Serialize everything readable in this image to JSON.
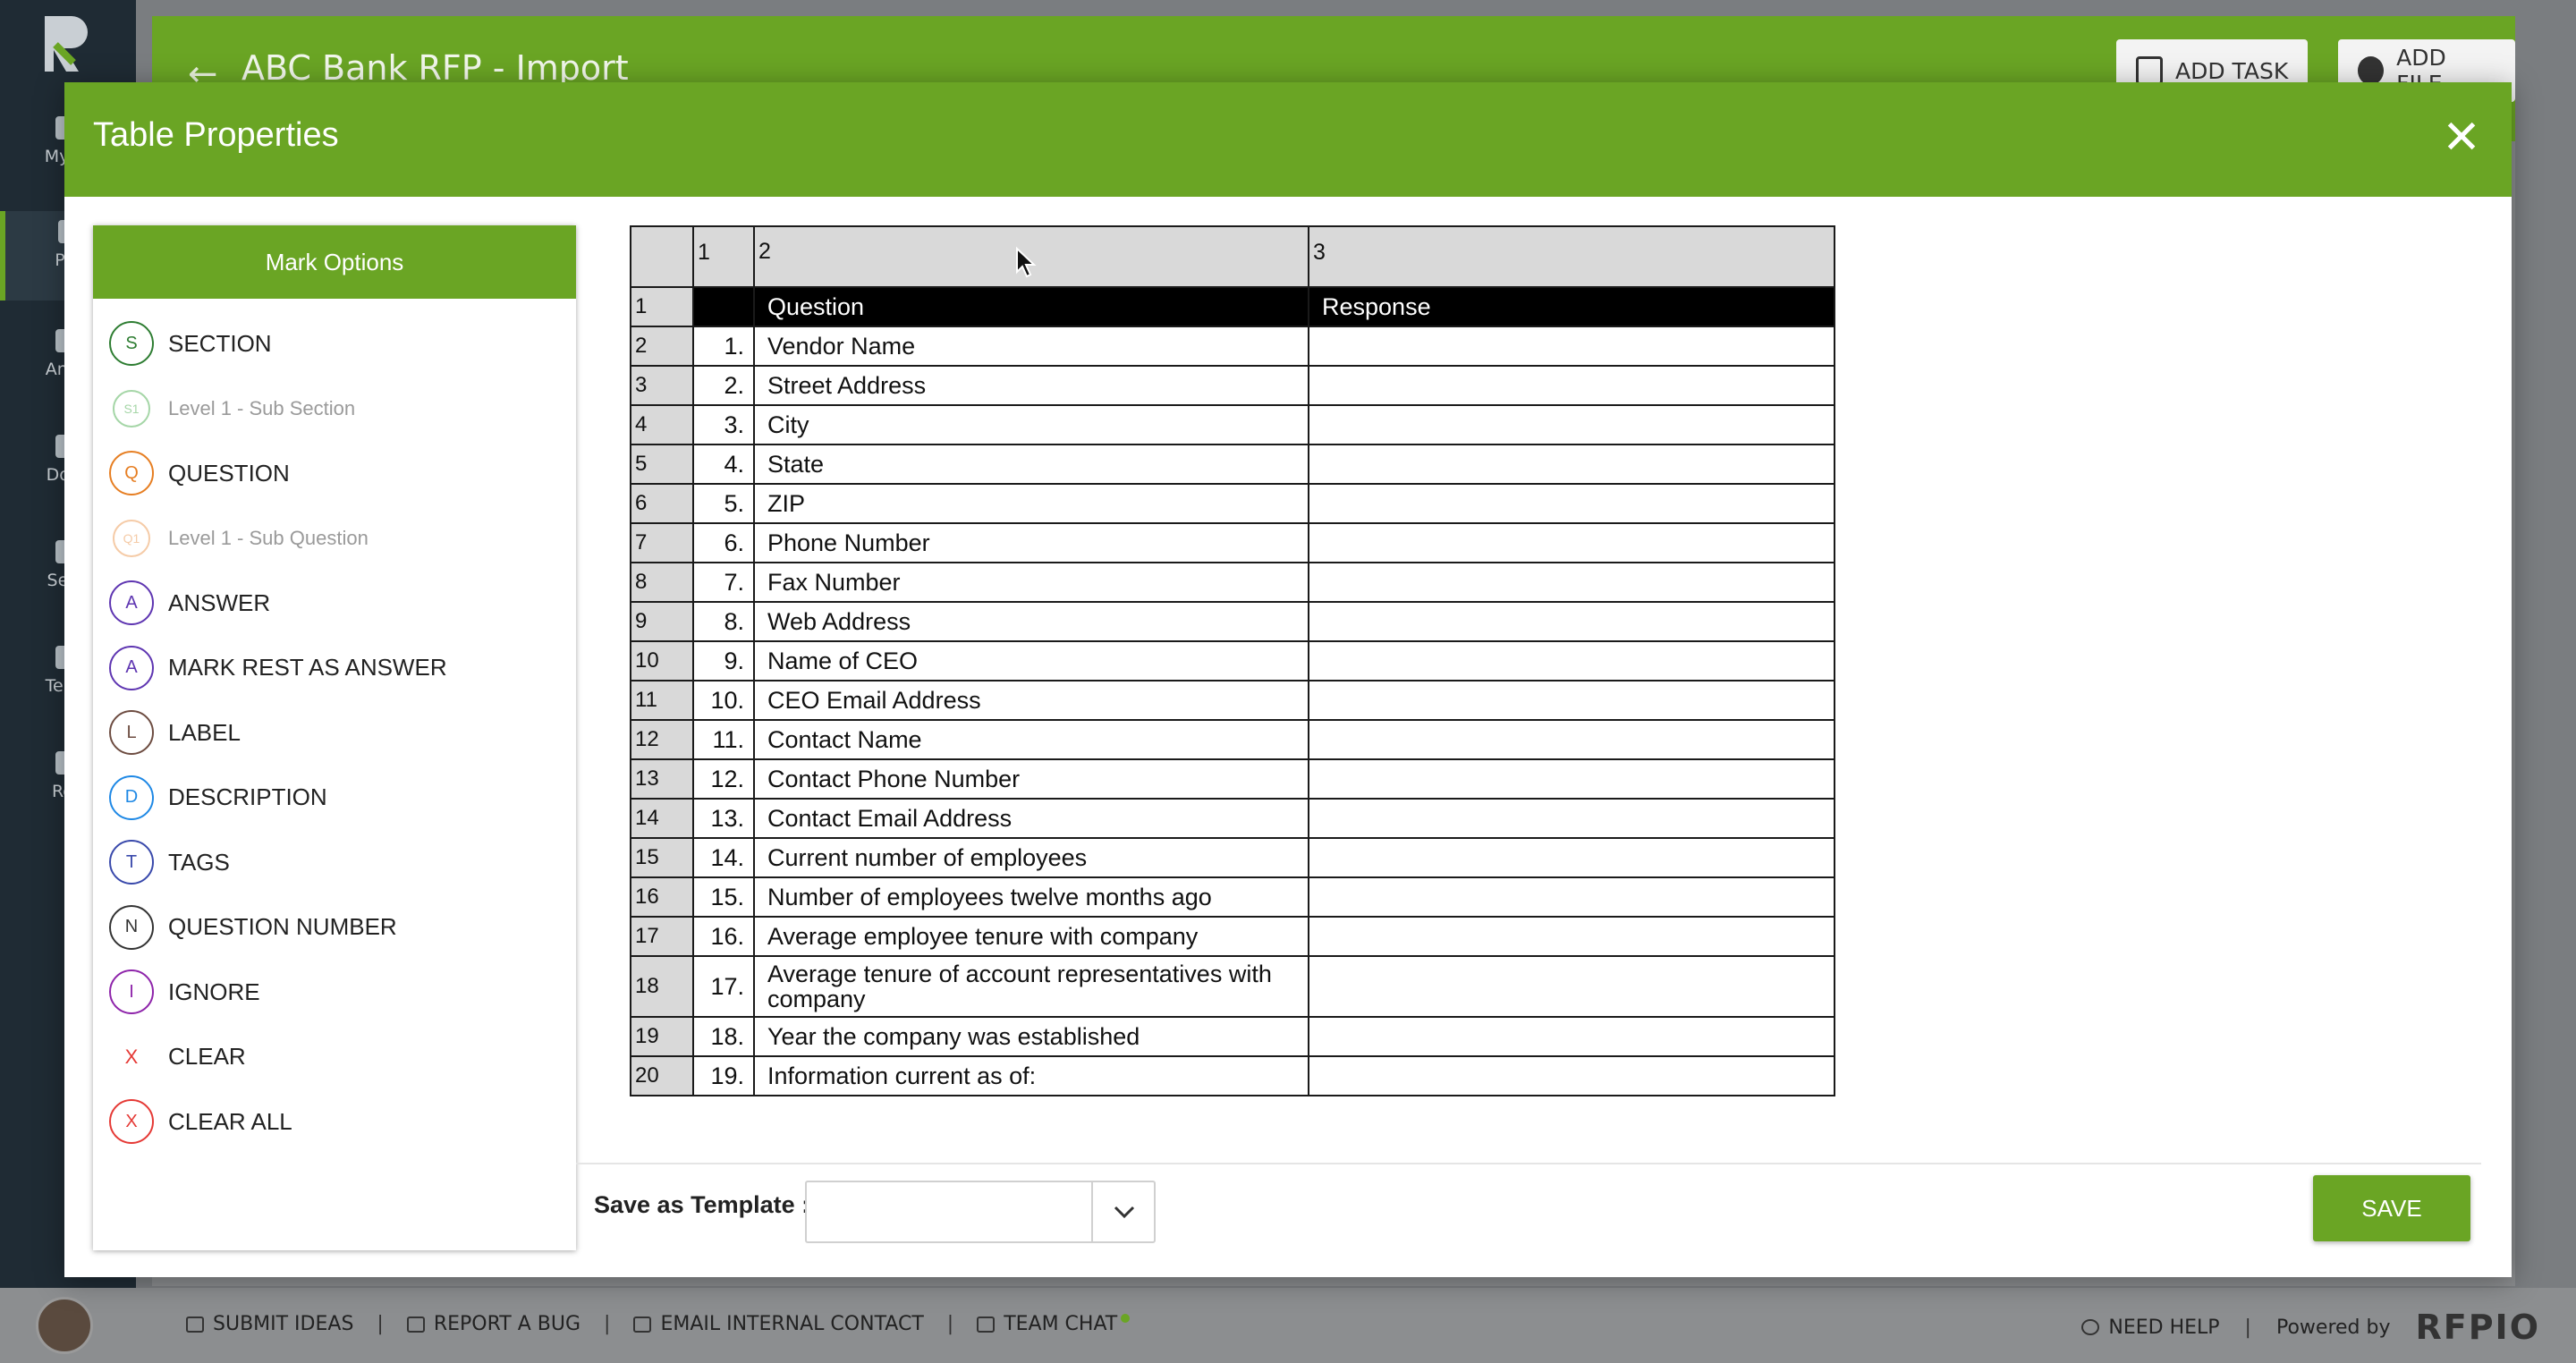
{
  "app": {
    "project_title": "ABC Bank RFP - Import",
    "add_task_label": "ADD TASK",
    "add_file_label": "ADD FILE",
    "rail_items": [
      "My W",
      "Proj",
      "Answ",
      "Docu",
      "Secti",
      "Temp",
      "Rep"
    ]
  },
  "bottom_bar": {
    "links": [
      "SUBMIT IDEAS",
      "REPORT A BUG",
      "EMAIL INTERNAL CONTACT",
      "TEAM CHAT"
    ],
    "need_help": "NEED HELP",
    "powered_by": "Powered by",
    "brand": "RFPIO"
  },
  "modal": {
    "title": "Table Properties",
    "close_icon": "close-icon"
  },
  "mark_options": {
    "heading": "Mark Options",
    "items": [
      {
        "letter": "S",
        "label": "SECTION",
        "color": "#2e7d32",
        "sub": false
      },
      {
        "letter": "S1",
        "label": "Level 1 - Sub Section",
        "color": "#a5d6a7",
        "sub": true
      },
      {
        "letter": "Q",
        "label": "QUESTION",
        "color": "#e67e22",
        "sub": false
      },
      {
        "letter": "Q1",
        "label": "Level 1 - Sub Question",
        "color": "#f5cba7",
        "sub": true
      },
      {
        "letter": "A",
        "label": "ANSWER",
        "color": "#5e35b1",
        "sub": false
      },
      {
        "letter": "A",
        "label": "MARK REST AS ANSWER",
        "color": "#5e35b1",
        "sub": false
      },
      {
        "letter": "L",
        "label": "LABEL",
        "color": "#6d4c41",
        "sub": false
      },
      {
        "letter": "D",
        "label": "DESCRIPTION",
        "color": "#1e88e5",
        "sub": false
      },
      {
        "letter": "T",
        "label": "TAGS",
        "color": "#3949ab",
        "sub": false
      },
      {
        "letter": "N",
        "label": "QUESTION NUMBER",
        "color": "#333333",
        "sub": false
      },
      {
        "letter": "I",
        "label": "IGNORE",
        "color": "#8e24aa",
        "sub": false
      },
      {
        "letter": "X",
        "label": "CLEAR",
        "color": "#e53935",
        "sub": false,
        "plain": true
      },
      {
        "letter": "X",
        "label": "CLEAR ALL",
        "color": "#e53935",
        "sub": false
      }
    ]
  },
  "table": {
    "column_headers": [
      "1",
      "2",
      "3"
    ],
    "rows": [
      {
        "row": "1",
        "num": "",
        "question": "Question",
        "response": "Response",
        "header": true
      },
      {
        "row": "2",
        "num": "1.",
        "question": "Vendor Name",
        "response": ""
      },
      {
        "row": "3",
        "num": "2.",
        "question": "Street Address",
        "response": ""
      },
      {
        "row": "4",
        "num": "3.",
        "question": "City",
        "response": ""
      },
      {
        "row": "5",
        "num": "4.",
        "question": "State",
        "response": ""
      },
      {
        "row": "6",
        "num": "5.",
        "question": "ZIP",
        "response": ""
      },
      {
        "row": "7",
        "num": "6.",
        "question": "Phone Number",
        "response": ""
      },
      {
        "row": "8",
        "num": "7.",
        "question": "Fax Number",
        "response": ""
      },
      {
        "row": "9",
        "num": "8.",
        "question": "Web Address",
        "response": ""
      },
      {
        "row": "10",
        "num": "9.",
        "question": "Name of CEO",
        "response": ""
      },
      {
        "row": "11",
        "num": "10.",
        "question": "CEO Email Address",
        "response": ""
      },
      {
        "row": "12",
        "num": "11.",
        "question": "Contact Name",
        "response": ""
      },
      {
        "row": "13",
        "num": "12.",
        "question": "Contact Phone Number",
        "response": ""
      },
      {
        "row": "14",
        "num": "13.",
        "question": "Contact Email Address",
        "response": ""
      },
      {
        "row": "15",
        "num": "14.",
        "question": "Current number of employees",
        "response": ""
      },
      {
        "row": "16",
        "num": "15.",
        "question": "Number of employees twelve months ago",
        "response": ""
      },
      {
        "row": "17",
        "num": "16.",
        "question": "Average employee tenure with company",
        "response": ""
      },
      {
        "row": "18",
        "num": "17.",
        "question": "Average tenure of account representatives with company",
        "response": "",
        "tall": true
      },
      {
        "row": "19",
        "num": "18.",
        "question": "Year the company was established",
        "response": ""
      },
      {
        "row": "20",
        "num": "19.",
        "question": "Information current as of:",
        "response": ""
      }
    ]
  },
  "footer": {
    "template_label": "Save as Template :",
    "template_value": "",
    "save_label": "SAVE"
  }
}
